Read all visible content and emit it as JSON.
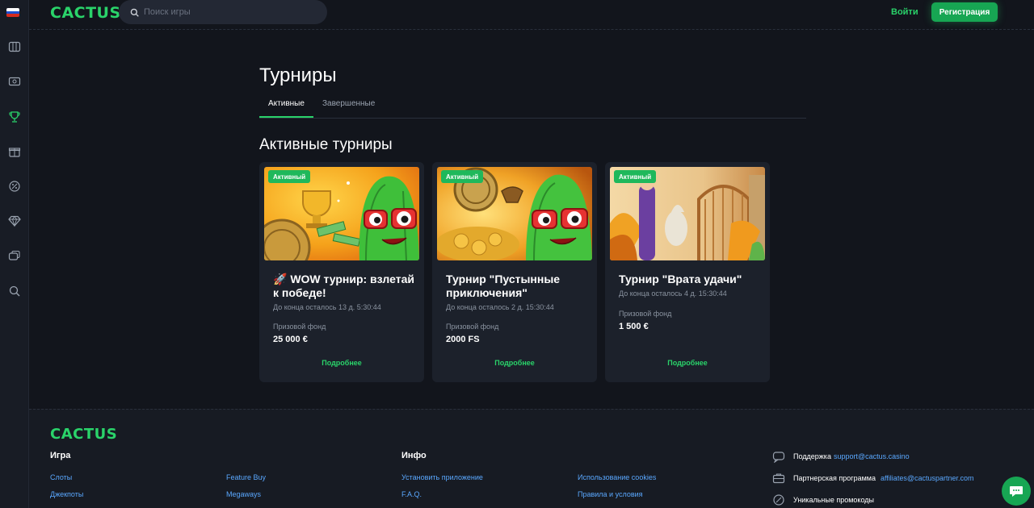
{
  "brand": {
    "logo": "CACTUS",
    "accent": "#2ad36a"
  },
  "header": {
    "search_placeholder": "Поиск игры",
    "login": "Войти",
    "register": "Регистрация"
  },
  "sidebar": {
    "items": [
      "flag-ru-icon",
      "slots-icon",
      "ticket-icon",
      "trophy-icon",
      "gift-icon",
      "promo-icon",
      "diamond-icon",
      "chat-icon",
      "search-icon"
    ]
  },
  "main": {
    "title": "Турниры",
    "tabs": [
      {
        "label": "Активные",
        "active": true
      },
      {
        "label": "Завершенные",
        "active": false
      }
    ],
    "section_title": "Активные турниры",
    "cards": [
      {
        "badge": "Активный",
        "title": "🚀 WOW турнир: взлетай к победе!",
        "timer": "До конца осталось 13 д. 5:30:44",
        "prize_label": "Призовой фонд",
        "prize_value": "25 000 €",
        "more": "Подробнее"
      },
      {
        "badge": "Активный",
        "title": "Турнир \"Пустынные приключения\"",
        "timer": "До конца осталось 2 д. 15:30:44",
        "prize_label": "Призовой фонд",
        "prize_value": "2000 FS",
        "more": "Подробнее"
      },
      {
        "badge": "Активный",
        "title": "Турнир \"Врата удачи\"",
        "timer": "До конца осталось 4 д. 15:30:44",
        "prize_label": "Призовой фонд",
        "prize_value": "1 500 €",
        "more": "Подробнее"
      }
    ]
  },
  "footer": {
    "logo": "CACTUS",
    "game_heading": "Игра",
    "info_heading": "Инфо",
    "game_links": [
      "Слоты",
      "Джекпоты",
      "Feature Buy",
      "Megaways"
    ],
    "info_links": [
      "Установить приложение",
      "F.A.Q.",
      "Использование cookies",
      "Правила и условия"
    ],
    "support_label": "Поддержка",
    "support_email": "support@cactus.casino",
    "partner_label": "Партнерская программа",
    "partner_email": "affiliates@cactuspartner.com",
    "promo_label": "Уникальные промокоды"
  }
}
